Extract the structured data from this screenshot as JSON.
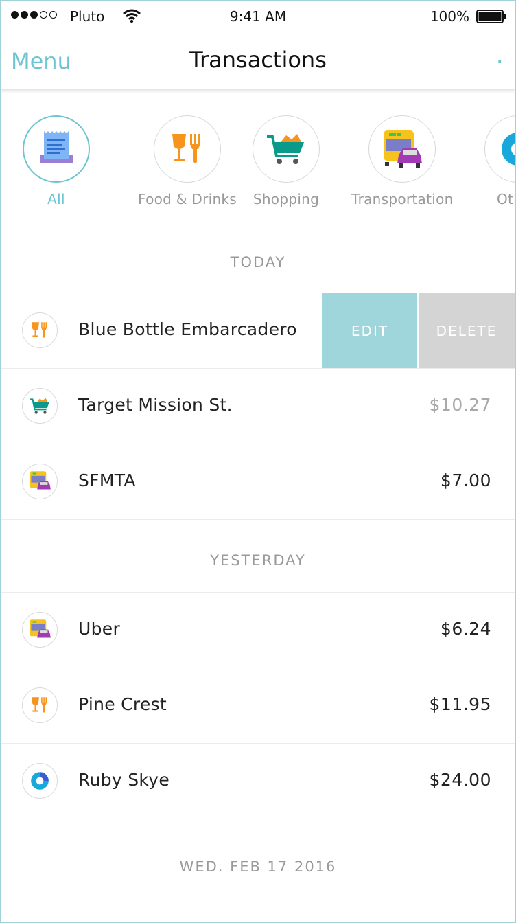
{
  "status_bar": {
    "carrier": "Pluto",
    "time": "9:41 AM",
    "battery": "100%"
  },
  "nav": {
    "menu_label": "Menu",
    "title": "Transactions",
    "more_label": "."
  },
  "categories": [
    {
      "label": "All",
      "icon": "receipt-icon",
      "active": true
    },
    {
      "label": "Food & Drinks",
      "icon": "food-drinks-icon",
      "active": false
    },
    {
      "label": "Shopping",
      "icon": "shopping-cart-icon",
      "active": false
    },
    {
      "label": "Transportation",
      "icon": "transportation-icon",
      "active": false
    },
    {
      "label": "Other",
      "icon": "other-icon",
      "active": false
    }
  ],
  "sections": {
    "today": "TODAY",
    "yesterday": "YESTERDAY",
    "date_footer": "WED. FEB 17 2016"
  },
  "today_rows": [
    {
      "name": "Blue Bottle Embarcadero",
      "amount": "",
      "icon": "food-drinks-icon",
      "edit_label": "EDIT",
      "delete_label": "DELETE"
    },
    {
      "name": "Target Mission St.",
      "amount": "$10.27",
      "icon": "shopping-cart-icon"
    },
    {
      "name": "SFMTA",
      "amount": "$7.00",
      "icon": "transportation-icon"
    }
  ],
  "yesterday_rows": [
    {
      "name": "Uber",
      "amount": "$6.24",
      "icon": "transportation-icon"
    },
    {
      "name": "Pine Crest",
      "amount": "$11.95",
      "icon": "food-drinks-icon"
    },
    {
      "name": "Ruby Skye",
      "amount": "$24.00",
      "icon": "other-icon"
    }
  ],
  "colors": {
    "accent": "#6cc5d0",
    "edit": "#9ed6dc",
    "delete": "#d4d4d4",
    "food": "#f7941d",
    "shopping": "#0a9a8c",
    "transport": "#f6c31c"
  }
}
